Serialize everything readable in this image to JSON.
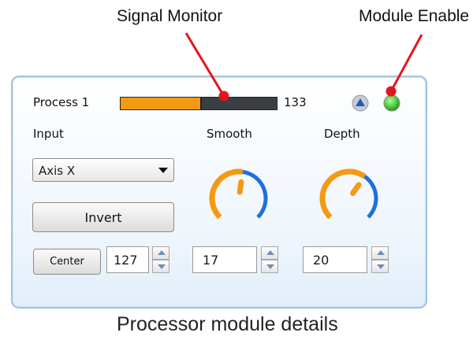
{
  "annotations": {
    "signal_monitor": "Signal Monitor",
    "module_enable": "Module Enable",
    "caption": "Processor  module details"
  },
  "module": {
    "title": "Process 1",
    "signal_value": "133",
    "signal_level_fraction": 0.52,
    "input_label": "Input",
    "smooth_label": "Smooth",
    "depth_label": "Depth",
    "input_select": {
      "selected": "Axis X"
    },
    "invert_label": "Invert",
    "center_label": "Center",
    "center_value": "127",
    "smooth_value": "17",
    "depth_value": "20",
    "smooth_knob_fraction": 0.53,
    "depth_knob_fraction": 0.63
  },
  "icons": {
    "up_arrow": "triangle-up-icon",
    "enable_led": "green-led-icon",
    "dropdown": "chevron-down-icon"
  },
  "colors": {
    "meter_fill": "#f39a12",
    "meter_track": "#3a3f44",
    "knob_orange": "#f39a12",
    "knob_blue": "#1e6fe0",
    "led_green": "#4ccf3a",
    "callout_red": "#e3151d",
    "panel_border": "#9fc4e4"
  }
}
